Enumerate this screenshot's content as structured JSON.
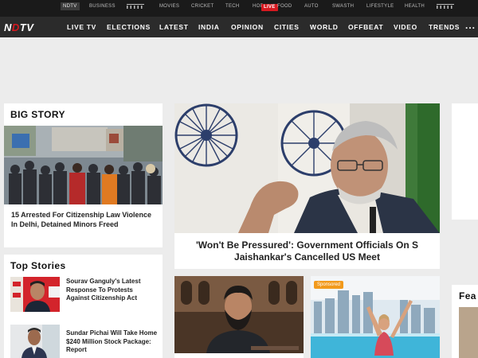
{
  "topbar": {
    "items": [
      {
        "label": "NDTV"
      },
      {
        "label": "BUSINESS"
      },
      {
        "label": "MOVIES"
      },
      {
        "label": "CRICKET"
      },
      {
        "label": "TECH"
      },
      {
        "label": "HOP"
      },
      {
        "label": "FOOD"
      },
      {
        "label": "AUTO"
      },
      {
        "label": "SWASTH"
      },
      {
        "label": "LIFESTYLE"
      },
      {
        "label": "HEALTH"
      }
    ],
    "live_badge": "LIVE"
  },
  "mainnav": {
    "logo": "NDTV",
    "items": [
      {
        "label": "LIVE TV"
      },
      {
        "label": "ELECTIONS"
      },
      {
        "label": "LATEST"
      },
      {
        "label": "INDIA"
      },
      {
        "label": "OPINION"
      },
      {
        "label": "CITIES"
      },
      {
        "label": "WORLD"
      },
      {
        "label": "OFFBEAT"
      },
      {
        "label": "VIDEO"
      },
      {
        "label": "TRENDS"
      }
    ],
    "more": "..."
  },
  "big_story": {
    "title": "BIG STORY",
    "headline": "15 Arrested For Citizenship Law Violence In Delhi, Detained Minors Freed"
  },
  "hero": {
    "headline": "'Won't Be Pressured': Government Officials On S Jaishankar's Cancelled US Meet"
  },
  "top_stories": {
    "title": "Top Stories",
    "items": [
      {
        "headline": "Sourav Ganguly's Latest Response To Protests Against Citizenship Act"
      },
      {
        "headline": "Sundar Pichai Will Take Home $240 Million Stock Package: Report"
      }
    ]
  },
  "sponsored_card": {
    "badge": "Sponsored"
  },
  "right_card": {
    "title": "Fea"
  },
  "colors": {
    "topbar_bg": "#1a1a1a",
    "nav_bg": "#2b2b2b",
    "live_red": "#d71920",
    "sponsored_orange": "#f29a1c",
    "page_bg": "#ececec"
  }
}
